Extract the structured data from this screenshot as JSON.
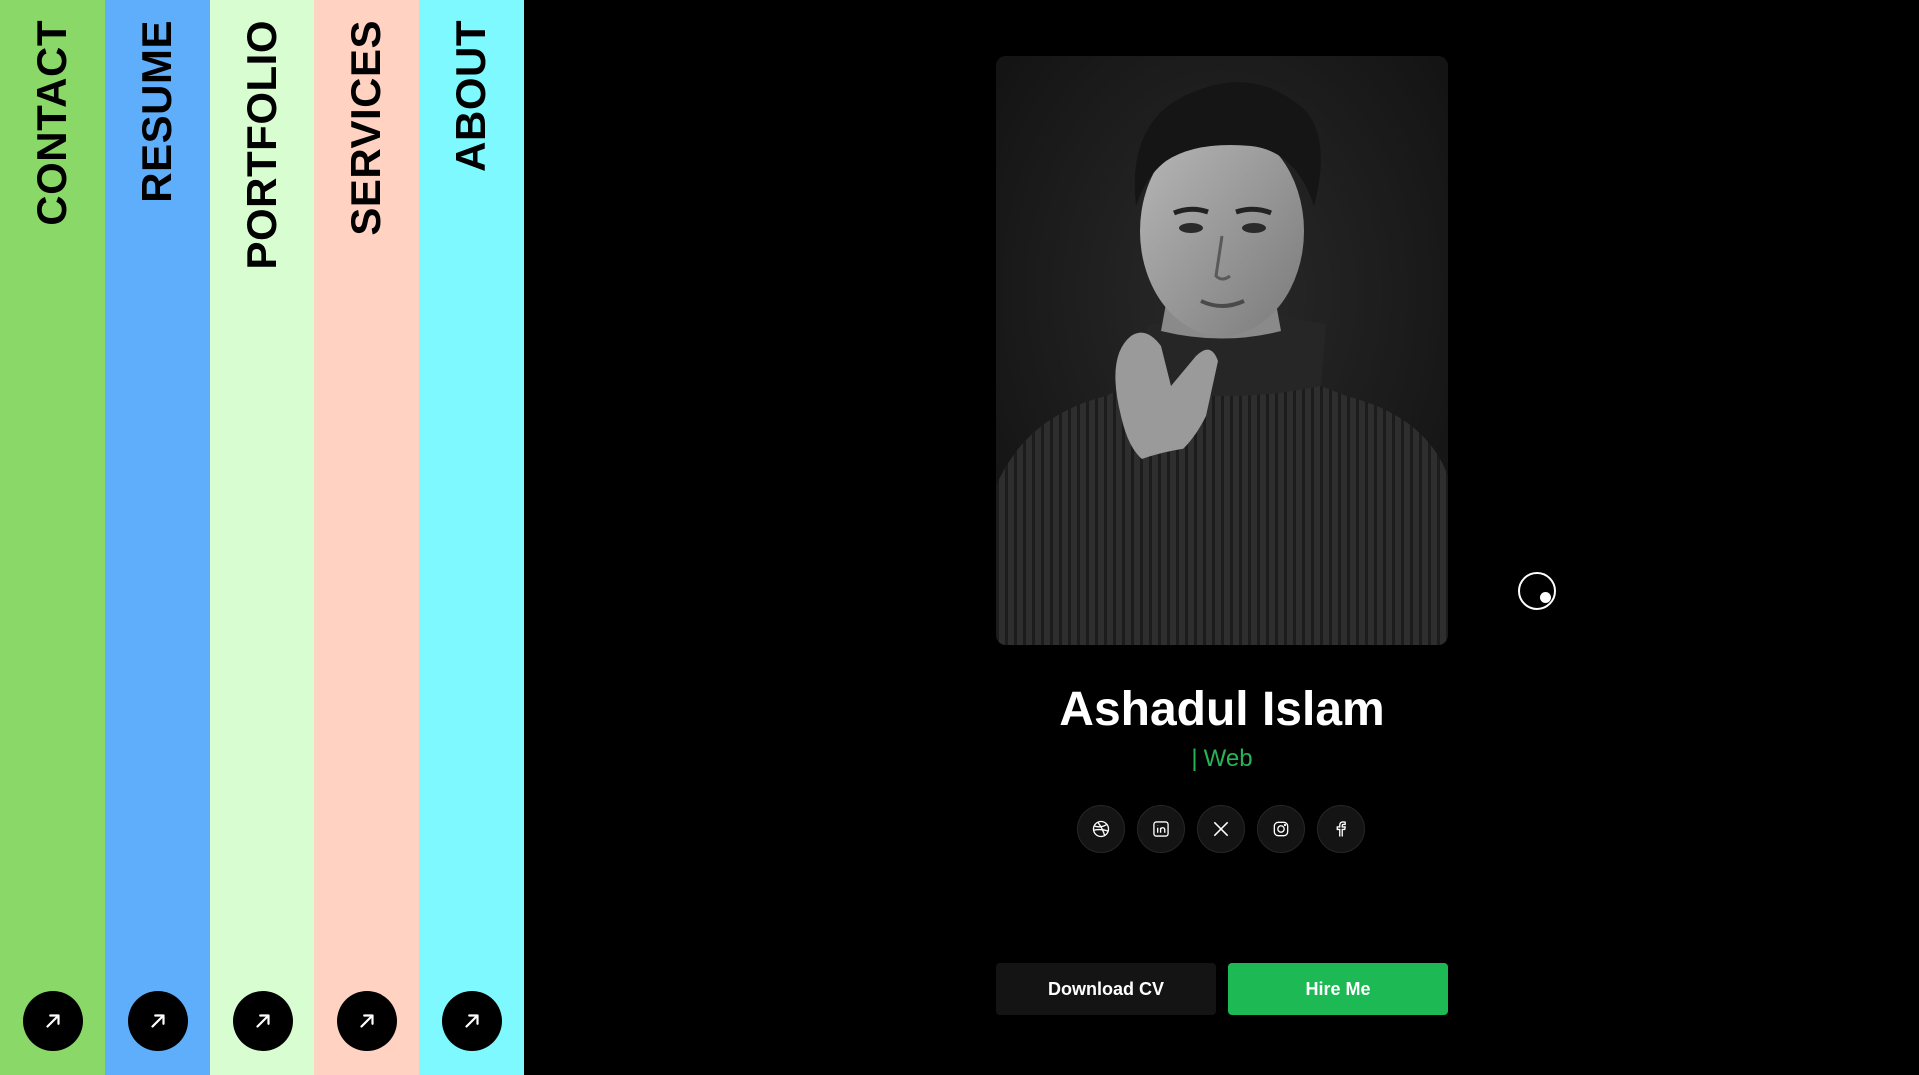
{
  "nav": {
    "items": [
      {
        "label": "CONTACT",
        "color": "#8ad868"
      },
      {
        "label": "RESUME",
        "color": "#5eaefc"
      },
      {
        "label": "PORTFOLIO",
        "color": "#d8fdd0"
      },
      {
        "label": "SERVICES",
        "color": "#ffd2c2"
      },
      {
        "label": "ABOUT",
        "color": "#7ef9ff"
      }
    ],
    "arrow_icon": "arrow-up-right-icon"
  },
  "profile": {
    "name": "Ashadul Islam",
    "role_prefix": "|",
    "role": "Web",
    "role_color": "#25b556"
  },
  "socials": [
    {
      "icon": "dribbble-icon"
    },
    {
      "icon": "linkedin-icon"
    },
    {
      "icon": "x-icon"
    },
    {
      "icon": "instagram-icon"
    },
    {
      "icon": "facebook-icon"
    }
  ],
  "actions": {
    "download_label": "Download CV",
    "hire_label": "Hire Me",
    "hire_color": "#1db954"
  }
}
